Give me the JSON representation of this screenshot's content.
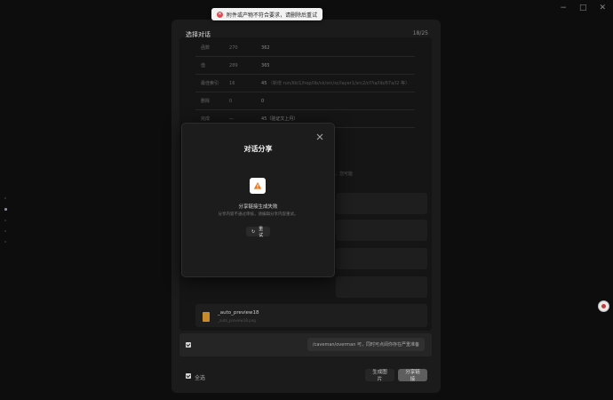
{
  "window": {
    "controls": [
      "−",
      "□",
      "✕"
    ]
  },
  "toast": {
    "text": "附件或产物不符合要求，请删除后重试"
  },
  "dialog": {
    "title": "选择对话",
    "count": "18/25",
    "table_rows": [
      {
        "key": "函数",
        "a": "270",
        "b": "362",
        "b_extra": ""
      },
      {
        "key": "值",
        "a": "289",
        "b": "365",
        "b_extra": ""
      },
      {
        "key": "最佳索引",
        "a": "16",
        "b": "45",
        "b_extra": "（新增 run/lib/1/hop/lib/ck/src/sc/layer1/src2/cf?ia/lib/67a/l2 等）"
      },
      {
        "key": "删除",
        "a": "0",
        "b": "0",
        "b_extra": ""
      },
      {
        "key": "完成",
        "a": "—",
        "b": "45（验证文上月）",
        "b_extra": ""
      }
    ],
    "paragraph": "意，新增以模块数量作，最近重编码，您可能",
    "file": {
      "name": "_auto_preview18",
      "sub": "_auto_preview18.png"
    },
    "message": "/caveman/overman 可，同时可点阅你存在严重准备",
    "footer": {
      "select_all": "全选",
      "generate": "生成图片",
      "share": "分享链接"
    }
  },
  "modal": {
    "title": "对话分享",
    "fail_title": "分享链接生成失败",
    "fail_desc": "分享内容不通过审核，请编辑分享内容重试。",
    "retry": "重试"
  },
  "colors": {
    "accent_warning": "#e8761e",
    "error": "#e5484d",
    "file_icon": "#c88a2a"
  }
}
